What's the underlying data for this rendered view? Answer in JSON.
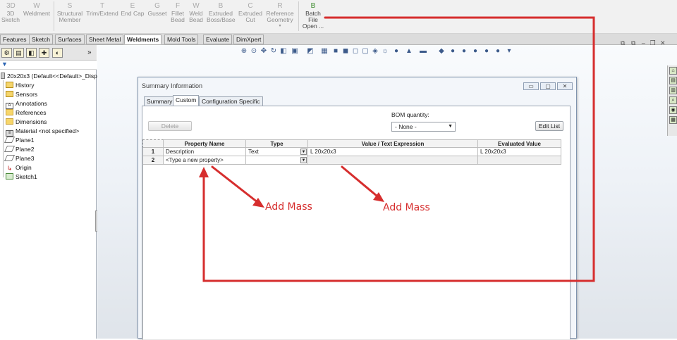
{
  "ribbon": {
    "buttons": [
      {
        "name": "3d-sketch",
        "line1": "3D",
        "line2": "Sketch",
        "icon": "3D"
      },
      {
        "name": "weldment",
        "line1": "Weldment",
        "line2": "",
        "icon": "W"
      },
      {
        "name": "structural-member",
        "line1": "Structural",
        "line2": "Member",
        "icon": "S"
      },
      {
        "name": "trim-extend",
        "line1": "Trim/Extend",
        "line2": "",
        "icon": "T"
      },
      {
        "name": "end-cap",
        "line1": "End Cap",
        "line2": "",
        "icon": "E"
      },
      {
        "name": "gusset",
        "line1": "Gusset",
        "line2": "",
        "icon": "G"
      },
      {
        "name": "fillet-bead",
        "line1": "Fillet",
        "line2": "Bead",
        "icon": "F"
      },
      {
        "name": "weld-bead",
        "line1": "Weld",
        "line2": "Bead",
        "icon": "W"
      },
      {
        "name": "extruded-boss-base",
        "line1": "Extruded",
        "line2": "Boss/Base",
        "icon": "B"
      },
      {
        "name": "extruded-cut",
        "line1": "Extruded",
        "line2": "Cut",
        "icon": "C"
      },
      {
        "name": "reference-geometry",
        "line1": "Reference",
        "line2": "Geometry",
        "icon": "R"
      }
    ],
    "batch": {
      "line1": "Batch",
      "line2": "File",
      "line3": "Open ...",
      "icon": "B"
    }
  },
  "tabs": [
    "Features",
    "Sketch",
    "Surfaces",
    "Sheet Metal",
    "Weldments",
    "Mold Tools",
    "Evaluate",
    "DimXpert"
  ],
  "active_tab": "Weldments",
  "tree": {
    "root": "20x20x3  (Default<<Default>_Disp",
    "items": [
      {
        "label": "History",
        "icon": "history-icon"
      },
      {
        "label": "Sensors",
        "icon": "sensors-icon"
      },
      {
        "label": "Annotations",
        "icon": "annotations-icon"
      },
      {
        "label": "References",
        "icon": "folder-icon"
      },
      {
        "label": "Dimensions",
        "icon": "folder-icon"
      },
      {
        "label": "Material <not specified>",
        "icon": "material-icon"
      },
      {
        "label": "Plane1",
        "icon": "plane-icon"
      },
      {
        "label": "Plane2",
        "icon": "plane-icon"
      },
      {
        "label": "Plane3",
        "icon": "plane-icon"
      },
      {
        "label": "Origin",
        "icon": "origin-icon"
      },
      {
        "label": "Sketch1",
        "icon": "sketch-icon"
      }
    ]
  },
  "dialog": {
    "title": "Summary Information",
    "tabs": [
      "Summary",
      "Custom",
      "Configuration Specific"
    ],
    "active_tab": "Custom",
    "delete_label": "Delete",
    "bom_label": "BOM quantity:",
    "bom_value": "- None -",
    "edit_list_label": "Edit List",
    "columns": [
      "Property Name",
      "Type",
      "Value / Text Expression",
      "Evaluated Value"
    ],
    "rows": [
      {
        "num": "1",
        "name": "Description",
        "type": "Text",
        "value": "L 20x20x3",
        "evaluated": "L 20x20x3"
      },
      {
        "num": "2",
        "name": "<Type a new property>",
        "type": "",
        "value": "",
        "evaluated": ""
      }
    ]
  },
  "annotations": [
    "Add Mass",
    "Add Mass"
  ],
  "colors": {
    "annotation": "#d62e2e",
    "dialog_border": "#7f93ad"
  }
}
